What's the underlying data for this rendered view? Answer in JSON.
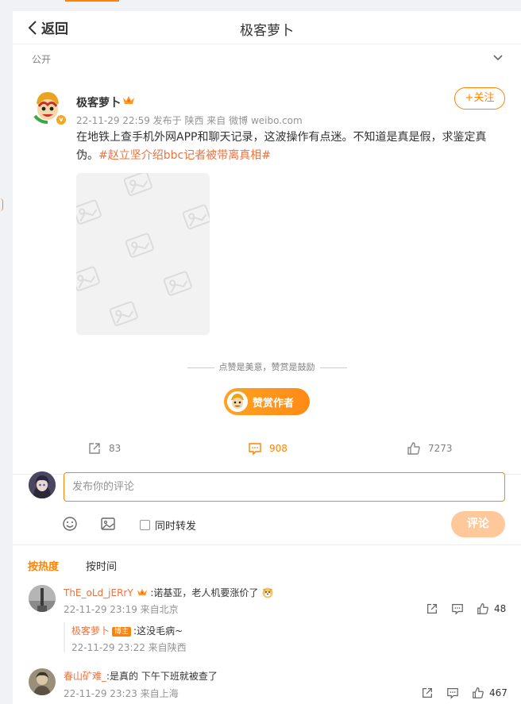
{
  "header": {
    "back_label": "返回",
    "title": "极客萝卜"
  },
  "visibility": "公开",
  "post": {
    "author": "极客萝卜",
    "follow_label": "+关注",
    "meta": "22-11-29 22:59  发布于 陕西  来自 微博 weibo.com",
    "text": "在地铁上查手机外网APP和聊天记录，这波操作有点迷。不知道是真是假，求鉴定真伪。",
    "hashtag": "#赵立坚介绍bbc记者被带离真相#"
  },
  "reward": {
    "hint": "点赞是美意，赞赏是鼓励",
    "button_label": "赞赏作者"
  },
  "actions": {
    "repost_count": "83",
    "comment_count": "908",
    "like_count": "7273"
  },
  "composer": {
    "placeholder": "发布你的评论",
    "repost_label": "同时转发",
    "submit_label": "评论"
  },
  "sort": {
    "hot": "按热度",
    "time": "按时间"
  },
  "comments": [
    {
      "user": "ThE_oLd_jERrY",
      "text": ":诺基亚，老人机要涨价了",
      "time": "22-11-29 23:19 来自北京",
      "likes": "48",
      "reply": {
        "user": "极客萝卜",
        "badge": "博主",
        "text": ":这没毛病~",
        "time": "22-11-29 23:22 来自陕西"
      }
    },
    {
      "user": "春山矿难_",
      "text": ":是真的 下午下班就被查了",
      "time": "22-11-29 23:23 来自上海",
      "likes": "467"
    }
  ],
  "colors": {
    "accent": "#ff8200",
    "link": "#eb7340",
    "muted": "#939393"
  },
  "icons": [
    "chevron-left-icon",
    "chevron-down-icon",
    "crown-icon",
    "verified-icon",
    "image-placeholder-icon",
    "repost-icon",
    "comment-icon",
    "like-icon",
    "emoji-icon",
    "picture-icon"
  ]
}
